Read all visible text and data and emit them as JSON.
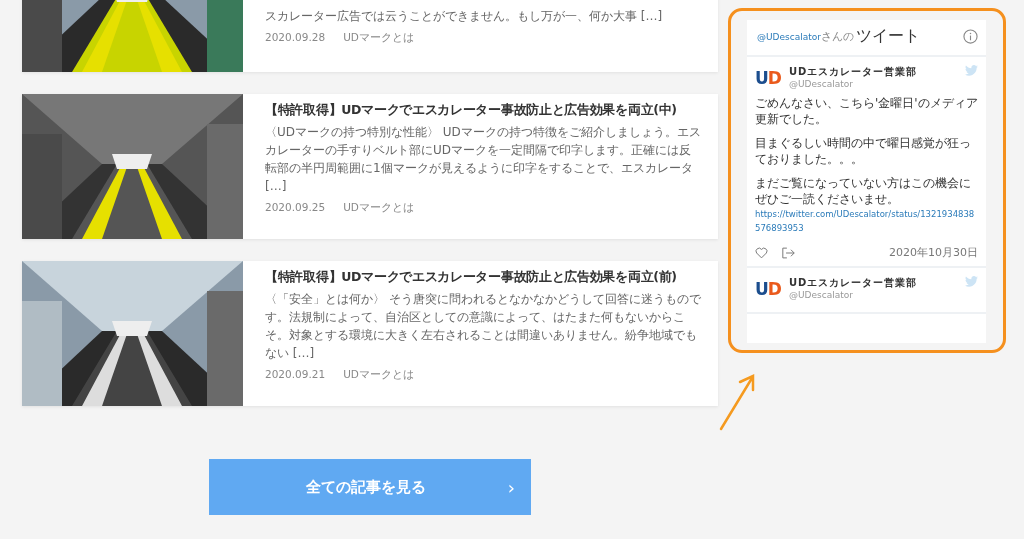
{
  "articles": [
    {
      "excerpt": "スカレーター広告では云うことができません。もし万が一、何か大事 […]",
      "date": "2020.09.28",
      "category": "UDマークとは",
      "cut": true
    },
    {
      "title": "【特許取得】UDマークでエスカレーター事故防止と広告効果を両立(中)",
      "excerpt": "〈UDマークの持つ特別な性能〉 UDマークの持つ特徴をご紹介しましょう。エスカレーターの手すりベルト部にUDマークを一定間隔で印字します。正確には反転部の半円周範囲に1個マークが見えるように印字をすることで、エスカレータ […]",
      "date": "2020.09.25",
      "category": "UDマークとは",
      "cut": false
    },
    {
      "title": "【特許取得】UDマークでエスカレーター事故防止と広告効果を両立(前)",
      "excerpt": "〈「安全」とは何か〉 そう唐突に問われるとなかなかどうして回答に迷うものです。法規制によって、自治区としての意識によって、はたまた何もないからこそ。対象とする環境に大きく左右されることは間違いありません。紛争地域でもない […]",
      "date": "2020.09.21",
      "category": "UDマークとは",
      "cut": false
    }
  ],
  "more_button": {
    "label": "全ての記事を見る",
    "arrow": "›"
  },
  "twitter_widget": {
    "handle": "@UDescalator",
    "handle_suffix": "さんの",
    "title": "ツイート",
    "tweets": [
      {
        "logo": "UD",
        "name": "UDエスカレーター営業部",
        "username": "@UDescalator",
        "paragraphs": [
          "ごめんなさい、こちら'金曜日'のメディア更新でした。",
          "目まぐるしい時間の中で曜日感覚が狂っておりました。。。",
          "まだご覧になっていない方はこの機会にぜひご一読くださいませ。"
        ],
        "link": "https://twitter.com/UDescalator/status/1321934838576893953",
        "date": "2020年10月30日"
      },
      {
        "logo": "UD",
        "name": "UDエスカレーター営業部",
        "username": "@UDescalator"
      }
    ]
  }
}
